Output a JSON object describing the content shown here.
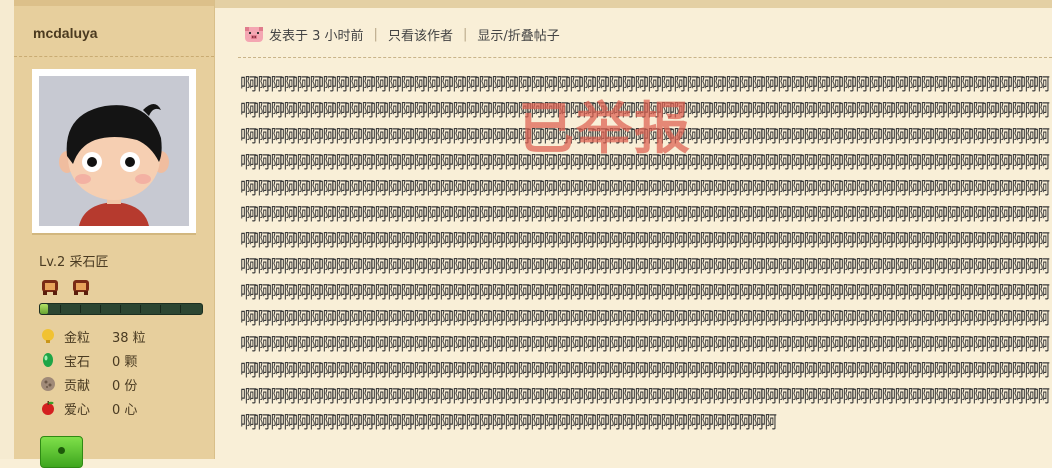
{
  "user": {
    "name": "mcdaluya",
    "level": "Lv.2 采石匠",
    "xp_progress": 0.05,
    "stats": [
      {
        "icon": "gold-nugget-icon",
        "label": "金粒",
        "value": "38 粒"
      },
      {
        "icon": "gem-icon",
        "label": "宝石",
        "value": "0 颗"
      },
      {
        "icon": "contribution-stone-icon",
        "label": "贡献",
        "value": "0 份"
      },
      {
        "icon": "apple-heart-icon",
        "label": "爱心",
        "value": "0 心"
      }
    ]
  },
  "post": {
    "posted_time": "发表于 3 小时前",
    "only_author_link": "只看该作者",
    "toggle_link": "显示/折叠帖子",
    "body_text": "啊啊啊啊啊啊啊啊啊啊啊啊啊啊啊啊啊啊啊啊啊啊啊啊啊啊啊啊啊啊啊啊啊啊啊啊啊啊啊啊啊啊啊啊啊啊啊啊啊啊啊啊啊啊啊啊啊啊啊啊啊啊啊啊啊啊啊啊啊啊啊啊啊啊啊啊啊啊啊啊啊啊啊啊啊啊啊啊啊啊啊啊啊啊啊啊啊啊啊啊啊啊啊啊啊啊啊啊啊啊啊啊啊啊啊啊啊啊啊啊啊啊啊啊啊啊啊啊啊啊啊啊啊啊啊啊啊啊啊啊啊啊啊啊啊啊啊啊啊啊啊啊啊啊啊啊啊啊啊啊啊啊啊啊啊啊啊啊啊啊啊啊啊啊啊啊啊啊啊啊啊啊啊啊啊啊啊啊啊啊啊啊啊啊啊啊啊啊啊啊啊啊啊啊啊啊啊啊啊啊啊啊啊啊啊啊啊啊啊啊啊啊啊啊啊啊啊啊啊啊啊啊啊啊啊啊啊啊啊啊啊啊啊啊啊啊啊啊啊啊啊啊啊啊啊啊啊啊啊啊啊啊啊啊啊啊啊啊啊啊啊啊啊啊啊啊啊啊啊啊啊啊啊啊啊啊啊啊啊啊啊啊啊啊啊啊啊啊啊啊啊啊啊啊啊啊啊啊啊啊啊啊啊啊啊啊啊啊啊啊啊啊啊啊啊啊啊啊啊啊啊啊啊啊啊啊啊啊啊啊啊啊啊啊啊啊啊啊啊啊啊啊啊啊啊啊啊啊啊啊啊啊啊啊啊啊啊啊啊啊啊啊啊啊啊啊啊啊啊啊啊啊啊啊啊啊啊啊啊啊啊啊啊啊啊啊啊啊啊啊啊啊啊啊啊啊啊啊啊啊啊啊啊啊啊啊啊啊啊啊啊啊啊啊啊啊啊啊啊啊啊啊啊啊啊啊啊啊啊啊啊啊啊啊啊啊啊啊啊啊啊啊啊啊啊啊啊啊啊啊啊啊啊啊啊啊啊啊啊啊啊啊啊啊啊啊啊啊啊啊啊啊啊啊啊啊啊啊啊啊啊啊啊啊啊啊啊啊啊啊啊啊啊啊啊啊啊啊啊啊啊啊啊啊啊啊啊啊啊啊啊啊啊啊啊啊啊啊啊啊啊啊啊啊啊啊啊啊啊啊啊啊啊啊啊啊啊啊啊啊啊啊啊啊啊啊啊啊啊啊啊啊啊啊啊啊啊啊啊啊啊啊啊啊啊啊啊啊啊啊啊啊啊啊啊啊啊啊啊啊啊啊啊啊啊啊啊啊啊啊啊啊啊啊啊啊啊啊啊啊啊啊啊啊啊啊啊啊啊啊啊啊啊啊啊啊啊啊啊啊啊啊啊啊啊啊啊啊啊啊啊啊啊啊啊啊啊啊啊啊啊啊啊啊啊啊啊啊啊啊啊啊啊啊啊啊啊啊啊啊啊啊啊啊啊啊啊啊啊啊啊啊啊啊啊啊啊啊啊啊啊啊啊啊啊啊啊啊啊啊啊啊啊啊啊啊啊啊啊啊啊啊啊啊啊啊啊啊啊啊啊啊啊啊啊啊啊啊啊啊啊啊啊啊啊啊啊啊啊啊啊啊啊啊啊啊啊啊啊啊啊啊啊啊啊啊啊啊啊啊啊啊啊啊啊啊啊啊啊啊啊啊啊啊啊啊啊啊啊啊啊啊啊啊啊啊啊啊啊啊啊啊啊啊啊啊啊啊啊啊啊啊啊啊啊啊啊啊啊啊啊啊啊啊啊啊啊啊啊啊啊啊啊啊啊啊啊啊啊啊啊啊啊啊啊啊啊啊啊啊啊啊啊啊啊啊啊",
    "stamp_text": "已举报"
  },
  "colors": {
    "sidebar_bg": "#e7cf9d",
    "page_bg": "#f9efd7",
    "stamp": "#dc5f50"
  }
}
